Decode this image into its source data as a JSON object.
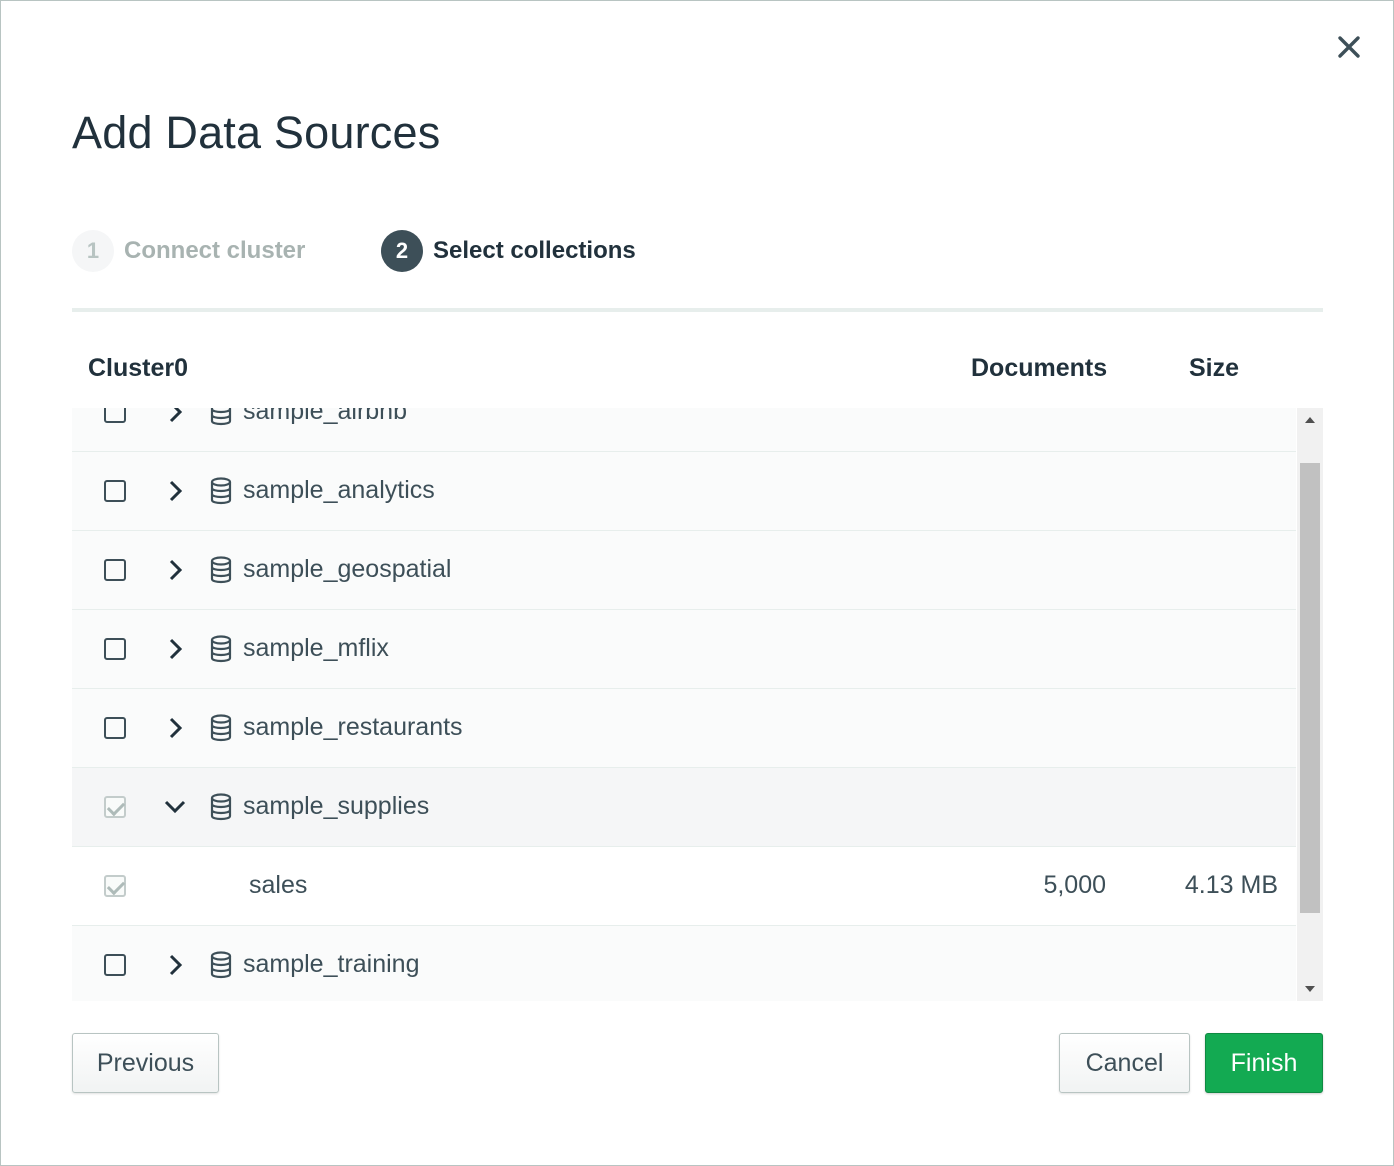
{
  "dialog": {
    "title": "Add Data Sources",
    "close_icon": "close-icon"
  },
  "steps": [
    {
      "number": "1",
      "label": "Connect cluster",
      "state": "complete"
    },
    {
      "number": "2",
      "label": "Select collections",
      "state": "active"
    }
  ],
  "table": {
    "cluster_name": "Cluster0",
    "documents_header": "Documents",
    "size_header": "Size"
  },
  "databases": [
    {
      "name": "sample_airbnb",
      "checked": false,
      "expanded": false
    },
    {
      "name": "sample_analytics",
      "checked": false,
      "expanded": false
    },
    {
      "name": "sample_geospatial",
      "checked": false,
      "expanded": false
    },
    {
      "name": "sample_mflix",
      "checked": false,
      "expanded": false
    },
    {
      "name": "sample_restaurants",
      "checked": false,
      "expanded": false
    },
    {
      "name": "sample_supplies",
      "checked": true,
      "expanded": true,
      "collections": [
        {
          "name": "sales",
          "documents": "5,000",
          "size": "4.13 MB",
          "checked": true
        }
      ]
    },
    {
      "name": "sample_training",
      "checked": false,
      "expanded": false
    }
  ],
  "icons": {
    "database": "database-icon",
    "chevron_right": "chevron-right-icon",
    "chevron_down": "chevron-down-icon"
  },
  "buttons": {
    "previous": "Previous",
    "cancel": "Cancel",
    "finish": "Finish"
  },
  "colors": {
    "primary": "#13aa52",
    "step_active": "#3d4f58",
    "text": "#3d4f58"
  }
}
